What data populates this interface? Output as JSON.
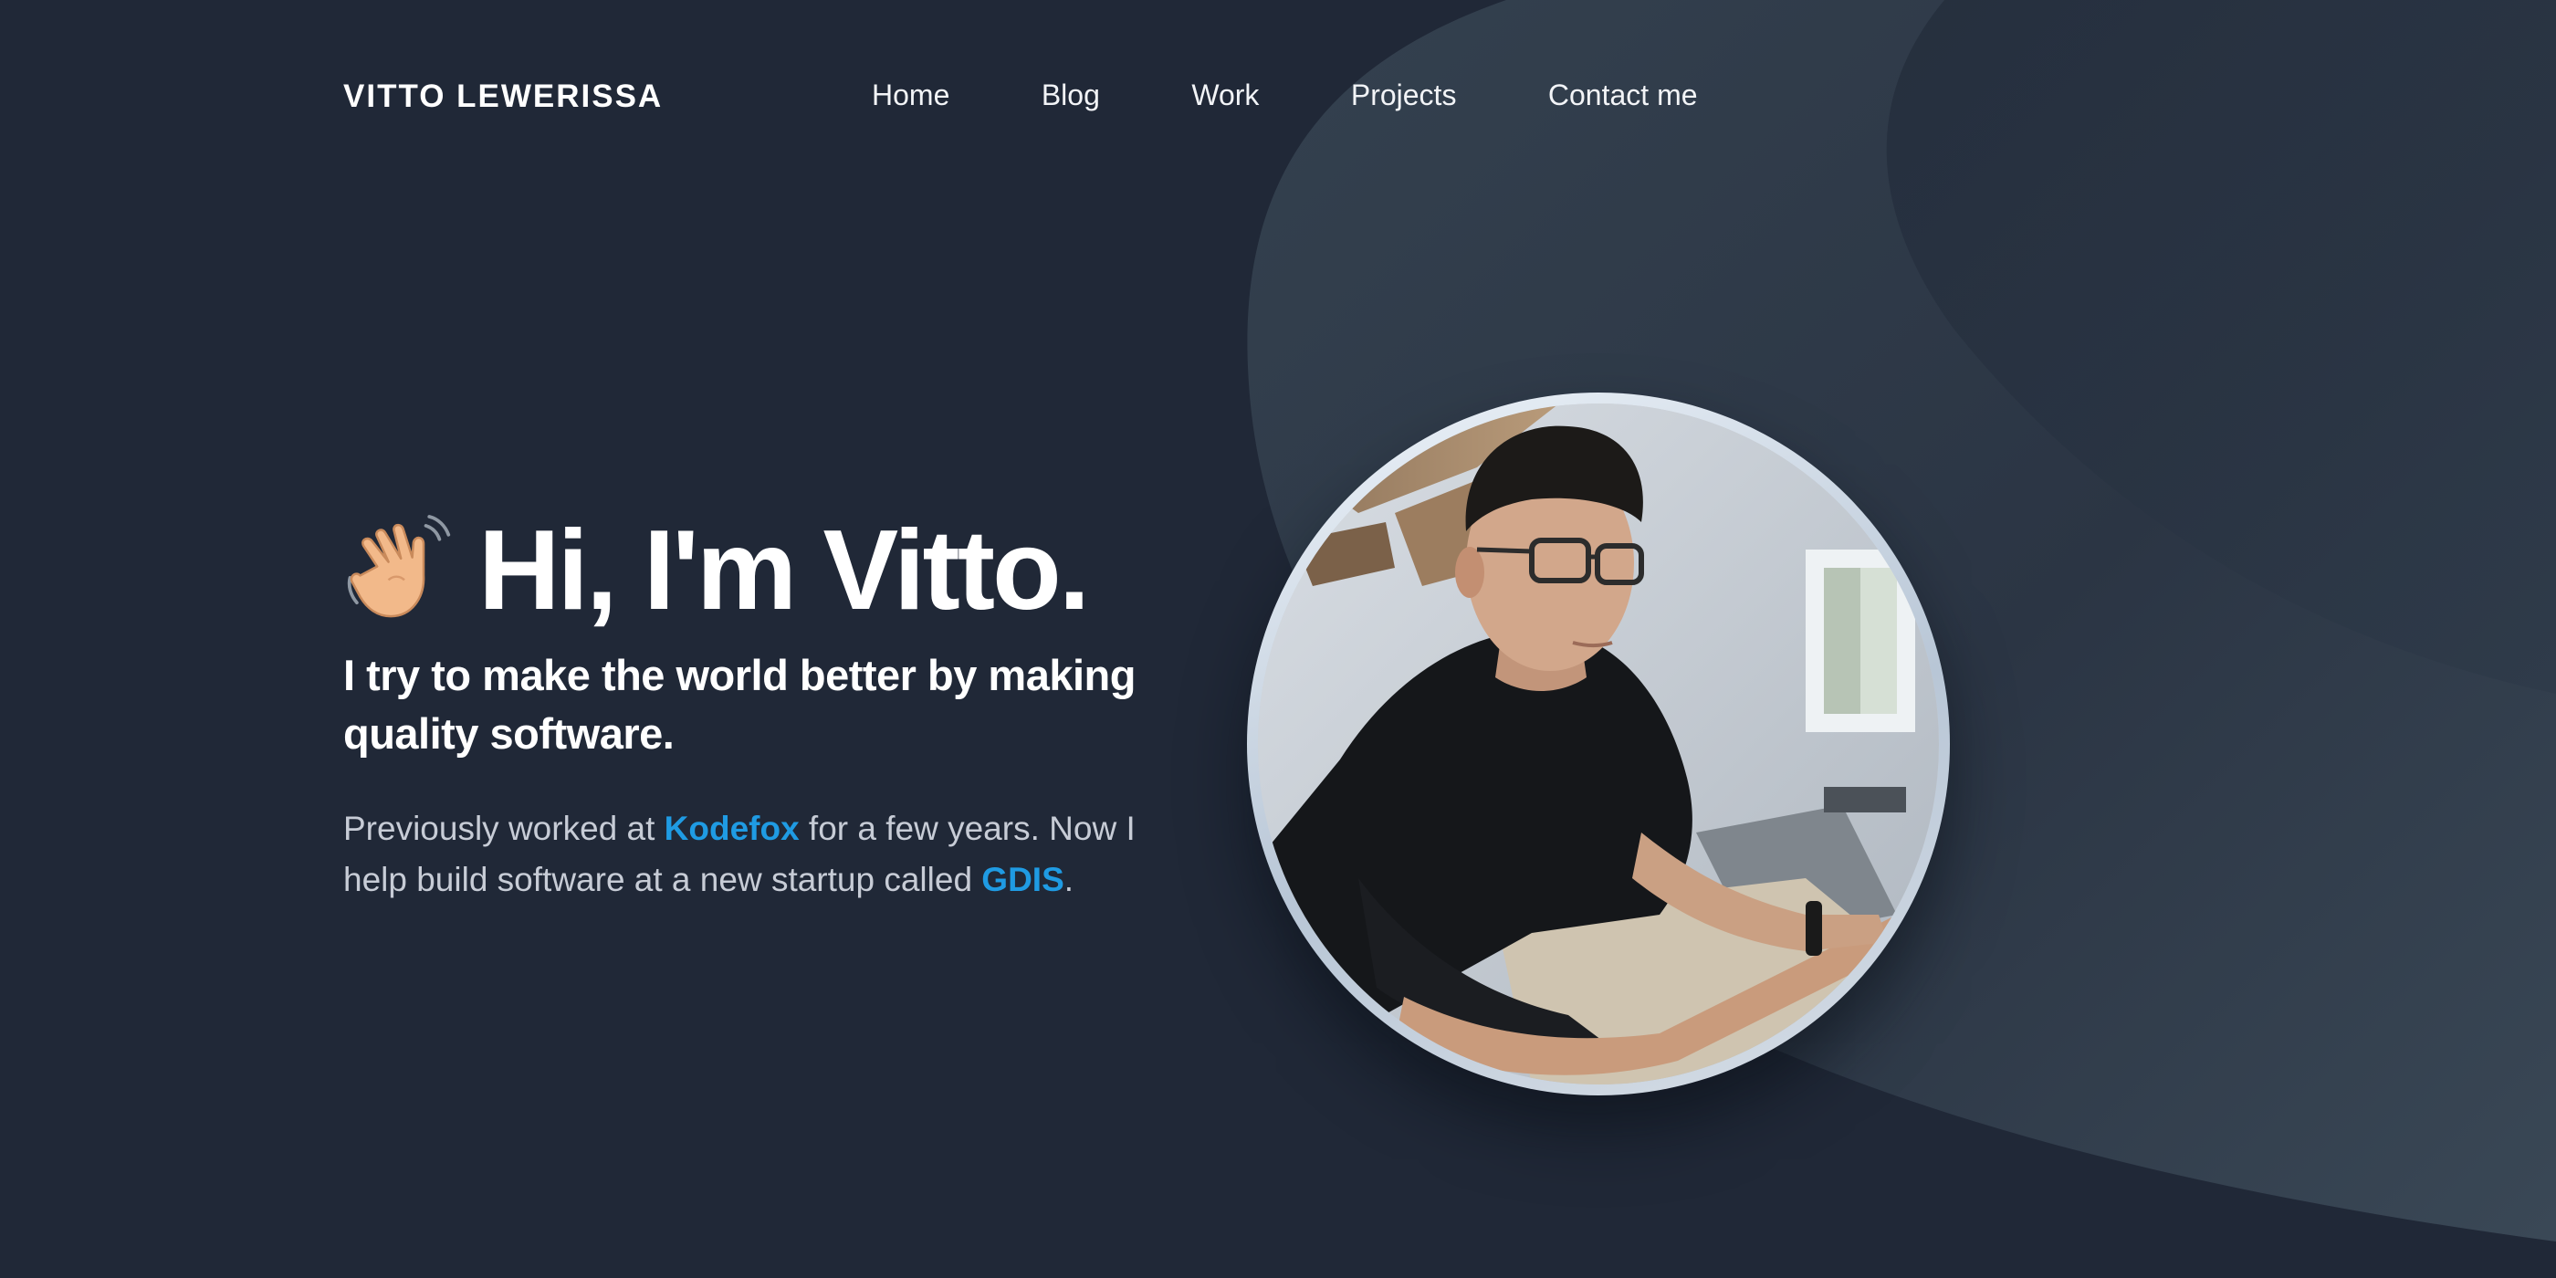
{
  "site": {
    "brand": "VITTO LEWERISSA"
  },
  "nav": {
    "items": [
      {
        "label": "Home"
      },
      {
        "label": "Blog"
      },
      {
        "label": "Work"
      },
      {
        "label": "Projects"
      },
      {
        "label": "Contact me"
      }
    ]
  },
  "hero": {
    "greeting": "Hi, I'm Vitto.",
    "greeting_icon": "waving-hand-icon",
    "tagline": "I try to make the world better by making quality software.",
    "bio": {
      "prefix": "Previously worked at ",
      "company1": "Kodefox",
      "middle": " for a few years. Now I help build software at a new startup called ",
      "company2": "GDIS",
      "suffix": "."
    }
  },
  "portrait": {
    "icon": "profile-photo"
  },
  "colors": {
    "background": "#202837",
    "accent": "#1f9be3",
    "shape": "#33404e",
    "text": "#ffffff",
    "muted_text": "#c7ccd6"
  }
}
